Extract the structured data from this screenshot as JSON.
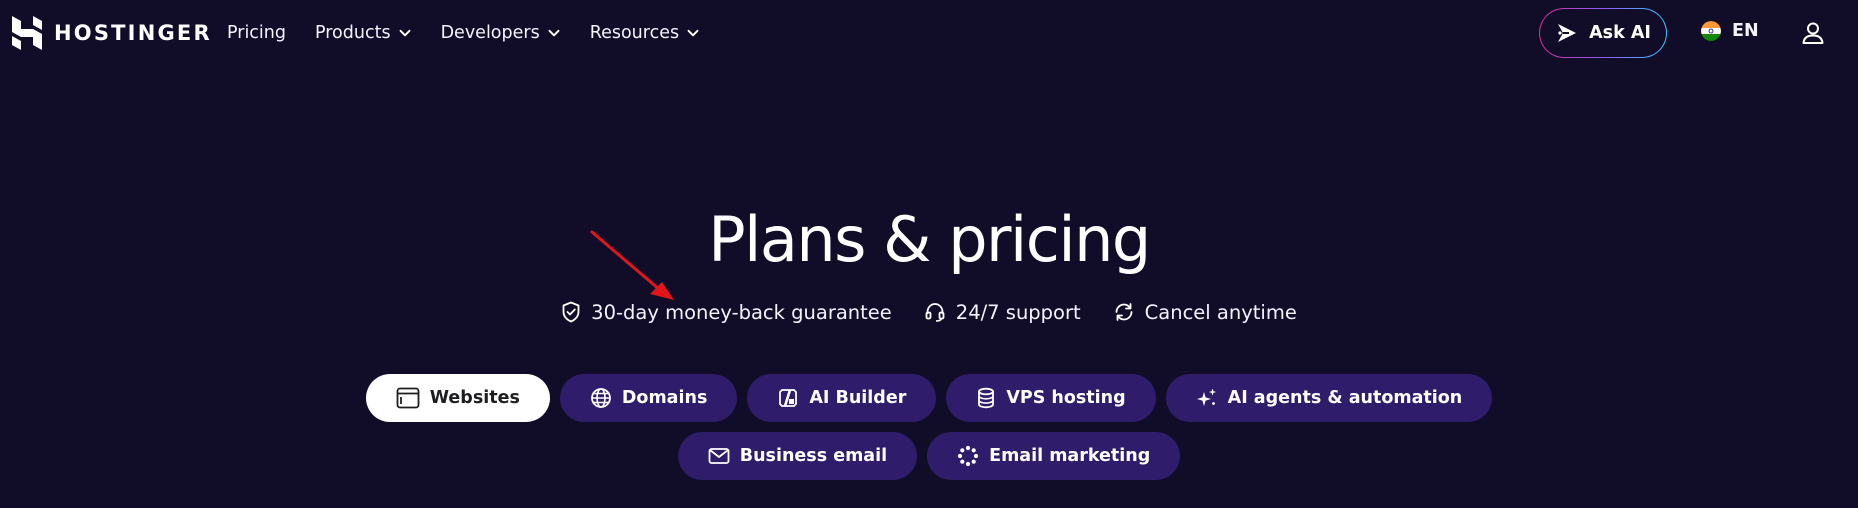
{
  "header": {
    "logo_text": "HOSTINGER",
    "nav": [
      {
        "label": "Pricing",
        "icon": ""
      },
      {
        "label": "Products",
        "icon": "chevron-down-icon"
      },
      {
        "label": "Developers",
        "icon": "chevron-down-icon"
      },
      {
        "label": "Resources",
        "icon": "chevron-down-icon"
      }
    ],
    "ask_ai_label": "Ask AI",
    "lang_label": "EN",
    "lang_flag": "india-flag-icon"
  },
  "hero": {
    "title": "Plans & pricing",
    "features": [
      {
        "label": "30-day money-back guarantee",
        "icon": "shield-check-icon"
      },
      {
        "label": "24/7 support",
        "icon": "headset-icon"
      },
      {
        "label": "Cancel anytime",
        "icon": "refresh-icon"
      }
    ],
    "annotation_arrow_color": "#e0161b"
  },
  "categories": {
    "row1": [
      {
        "label": "Websites",
        "icon": "browser-window-icon",
        "active": true
      },
      {
        "label": "Domains",
        "icon": "globe-icon",
        "active": false
      },
      {
        "label": "AI Builder",
        "icon": "ai-builder-icon",
        "active": false
      },
      {
        "label": "VPS hosting",
        "icon": "database-icon",
        "active": false
      },
      {
        "label": "AI agents & automation",
        "icon": "sparkles-icon",
        "active": false
      }
    ],
    "row2": [
      {
        "label": "Business email",
        "icon": "envelope-icon",
        "active": false
      },
      {
        "label": "Email marketing",
        "icon": "email-marketing-icon",
        "active": false
      }
    ]
  },
  "colors": {
    "background": "#110d29",
    "pill": "#2f1c6a",
    "pill_active": "#ffffff",
    "text": "#ffffff"
  }
}
